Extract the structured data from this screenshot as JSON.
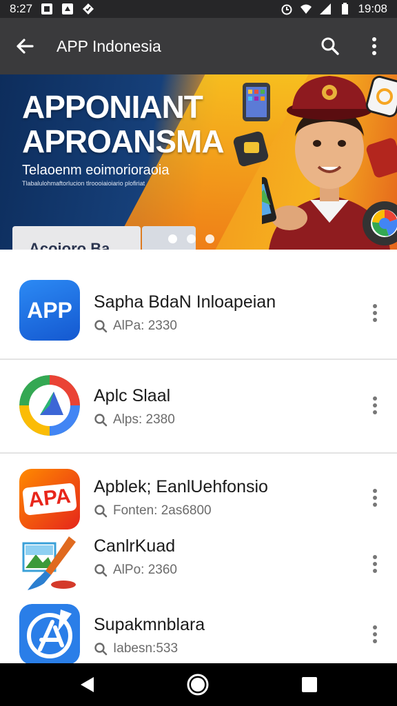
{
  "status_bar": {
    "time_left": "8:27",
    "clock": "19:08",
    "icons": [
      "notification-icon",
      "notification-icon",
      "notification-icon",
      "alarm-icon",
      "wifi-icon",
      "signal-icon",
      "battery-icon"
    ]
  },
  "app_bar": {
    "title": "APP Indonesia",
    "back_icon": "arrow-left-icon",
    "search_icon": "search-icon",
    "more_icon": "more-vertical-icon"
  },
  "banner": {
    "title_line1": "APPONIANT",
    "title_line2": "APROANSMA",
    "subtitle": "Telaoenm eoimorioraoia",
    "caption": "Tlabalulohmaftorlucion tlroooiaioiario plofiriat",
    "card_text": "Acoioro Ba",
    "page_count": 3,
    "active_page": 1
  },
  "apps": [
    {
      "name": "Sapha BdaN Inloapeian",
      "meta": "AlPa: 2330",
      "icon_text": "APP",
      "icon": "app-tile-icon"
    },
    {
      "name": "Aplc Slaal",
      "meta": "Alps: 2380",
      "icon_text": "",
      "icon": "play-style-icon"
    },
    {
      "name": "Apblek; EanlUehfonsio",
      "meta": "Fonten: 2as6800",
      "icon_text": "APA",
      "icon": "apa-tile-icon"
    },
    {
      "name": "CanlrKuad",
      "meta": "AlPo: 2360",
      "icon_text": "",
      "icon": "paint-brush-icon"
    },
    {
      "name": "Supakmnblara",
      "meta": "Iabesn:533",
      "icon_text": "",
      "icon": "app-store-icon"
    }
  ],
  "nav": {
    "back": "nav-back-icon",
    "home": "nav-home-icon",
    "recents": "nav-recents-icon"
  },
  "colors": {
    "app_bar": "#3a3a3c",
    "status_bar": "#262628",
    "banner_blue": "#16407a",
    "banner_orange": "#f39a1e"
  }
}
